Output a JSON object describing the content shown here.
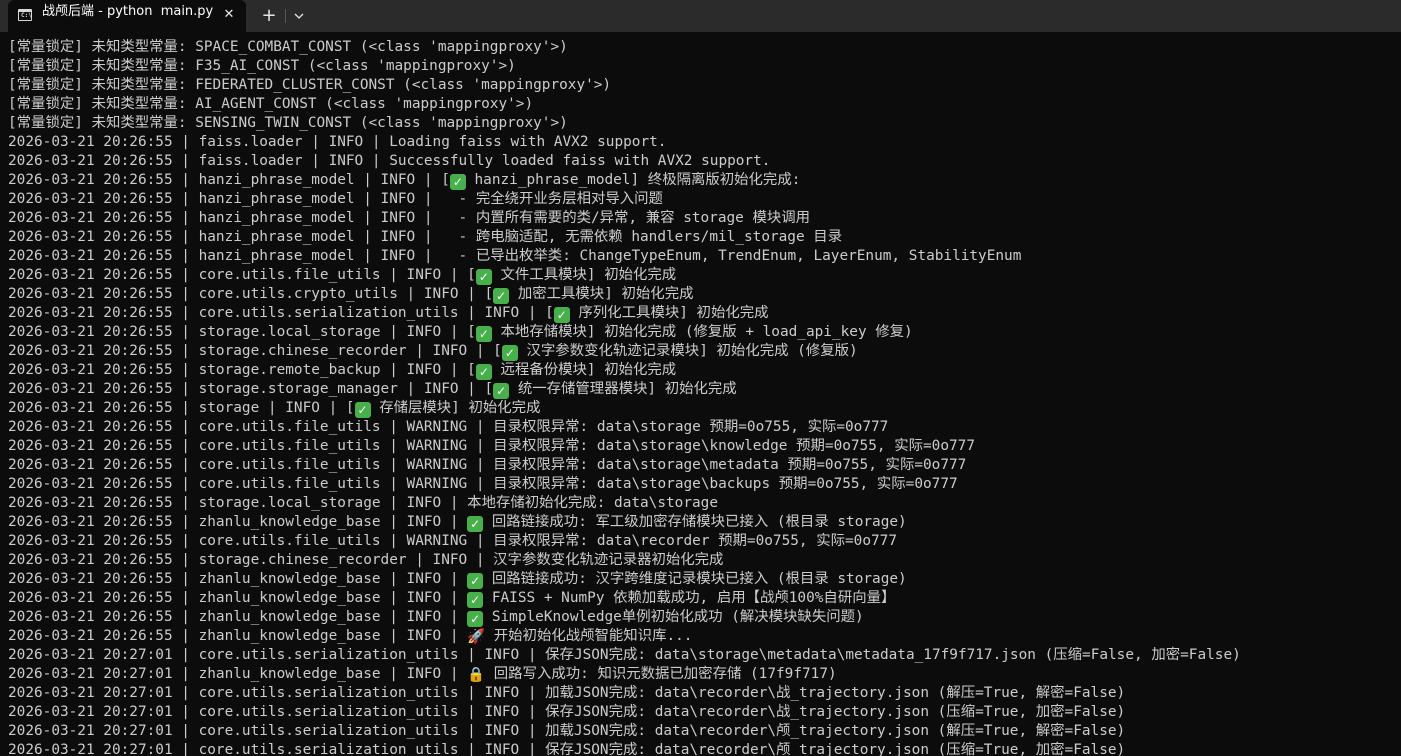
{
  "window": {
    "tab_title": "战颅后端 - python  main.py",
    "close_glyph": "✕",
    "new_tab_glyph": "+",
    "icons": {
      "tab": "terminal-icon",
      "close": "close-icon",
      "new_tab": "plus-icon",
      "dropdown": "chevron-down-icon"
    }
  },
  "console": {
    "lines": [
      "[常量锁定] 未知类型常量: SPACE_COMBAT_CONST (<class 'mappingproxy'>)",
      "[常量锁定] 未知类型常量: F35_AI_CONST (<class 'mappingproxy'>)",
      "[常量锁定] 未知类型常量: FEDERATED_CLUSTER_CONST (<class 'mappingproxy'>)",
      "[常量锁定] 未知类型常量: AI_AGENT_CONST (<class 'mappingproxy'>)",
      "[常量锁定] 未知类型常量: SENSING_TWIN_CONST (<class 'mappingproxy'>)",
      "2026-03-21 20:26:55 | faiss.loader | INFO | Loading faiss with AVX2 support.",
      "2026-03-21 20:26:55 | faiss.loader | INFO | Successfully loaded faiss with AVX2 support.",
      "2026-03-21 20:26:55 | hanzi_phrase_model | INFO | [✅ hanzi_phrase_model] 终极隔离版初始化完成:",
      "2026-03-21 20:26:55 | hanzi_phrase_model | INFO |   - 完全绕开业务层相对导入问题",
      "2026-03-21 20:26:55 | hanzi_phrase_model | INFO |   - 内置所有需要的类/异常, 兼容 storage 模块调用",
      "2026-03-21 20:26:55 | hanzi_phrase_model | INFO |   - 跨电脑适配, 无需依赖 handlers/mil_storage 目录",
      "2026-03-21 20:26:55 | hanzi_phrase_model | INFO |   - 已导出枚举类: ChangeTypeEnum, TrendEnum, LayerEnum, StabilityEnum",
      "2026-03-21 20:26:55 | core.utils.file_utils | INFO | [✅ 文件工具模块] 初始化完成",
      "2026-03-21 20:26:55 | core.utils.crypto_utils | INFO | [✅ 加密工具模块] 初始化完成",
      "2026-03-21 20:26:55 | core.utils.serialization_utils | INFO | [✅ 序列化工具模块] 初始化完成",
      "2026-03-21 20:26:55 | storage.local_storage | INFO | [✅ 本地存储模块] 初始化完成 (修复版 + load_api_key 修复)",
      "2026-03-21 20:26:55 | storage.chinese_recorder | INFO | [✅ 汉字参数变化轨迹记录模块] 初始化完成 (修复版)",
      "2026-03-21 20:26:55 | storage.remote_backup | INFO | [✅ 远程备份模块] 初始化完成",
      "2026-03-21 20:26:55 | storage.storage_manager | INFO | [✅ 统一存储管理器模块] 初始化完成",
      "2026-03-21 20:26:55 | storage | INFO | [✅ 存储层模块] 初始化完成",
      "2026-03-21 20:26:55 | core.utils.file_utils | WARNING | 目录权限异常: data\\storage 预期=0o755, 实际=0o777",
      "2026-03-21 20:26:55 | core.utils.file_utils | WARNING | 目录权限异常: data\\storage\\knowledge 预期=0o755, 实际=0o777",
      "2026-03-21 20:26:55 | core.utils.file_utils | WARNING | 目录权限异常: data\\storage\\metadata 预期=0o755, 实际=0o777",
      "2026-03-21 20:26:55 | core.utils.file_utils | WARNING | 目录权限异常: data\\storage\\backups 预期=0o755, 实际=0o777",
      "2026-03-21 20:26:55 | storage.local_storage | INFO | 本地存储初始化完成: data\\storage",
      "2026-03-21 20:26:55 | zhanlu_knowledge_base | INFO | ✅ 回路链接成功: 军工级加密存储模块已接入 (根目录 storage)",
      "2026-03-21 20:26:55 | core.utils.file_utils | WARNING | 目录权限异常: data\\recorder 预期=0o755, 实际=0o777",
      "2026-03-21 20:26:55 | storage.chinese_recorder | INFO | 汉字参数变化轨迹记录器初始化完成",
      "2026-03-21 20:26:55 | zhanlu_knowledge_base | INFO | ✅ 回路链接成功: 汉字跨维度记录模块已接入 (根目录 storage)",
      "2026-03-21 20:26:55 | zhanlu_knowledge_base | INFO | ✅ FAISS + NumPy 依赖加载成功, 启用【战颅100%自研向量】",
      "2026-03-21 20:26:55 | zhanlu_knowledge_base | INFO | ✅ SimpleKnowledge单例初始化成功 (解决模块缺失问题)",
      "2026-03-21 20:26:55 | zhanlu_knowledge_base | INFO | 🚀 开始初始化战颅智能知识库...",
      "2026-03-21 20:27:01 | core.utils.serialization_utils | INFO | 保存JSON完成: data\\storage\\metadata\\metadata_17f9f717.json (压缩=False, 加密=False)",
      "2026-03-21 20:27:01 | zhanlu_knowledge_base | INFO | 🔒 回路写入成功: 知识元数据已加密存储 (17f9f717)",
      "2026-03-21 20:27:01 | core.utils.serialization_utils | INFO | 加载JSON完成: data\\recorder\\战_trajectory.json (解压=True, 解密=False)",
      "2026-03-21 20:27:01 | core.utils.serialization_utils | INFO | 保存JSON完成: data\\recorder\\战_trajectory.json (压缩=True, 加密=False)",
      "2026-03-21 20:27:01 | core.utils.serialization_utils | INFO | 加载JSON完成: data\\recorder\\颅_trajectory.json (解压=True, 解密=False)",
      "2026-03-21 20:27:01 | core.utils.serialization_utils | INFO | 保存JSON完成: data\\recorder\\颅_trajectory.json (压缩=True, 加密=False)"
    ]
  }
}
